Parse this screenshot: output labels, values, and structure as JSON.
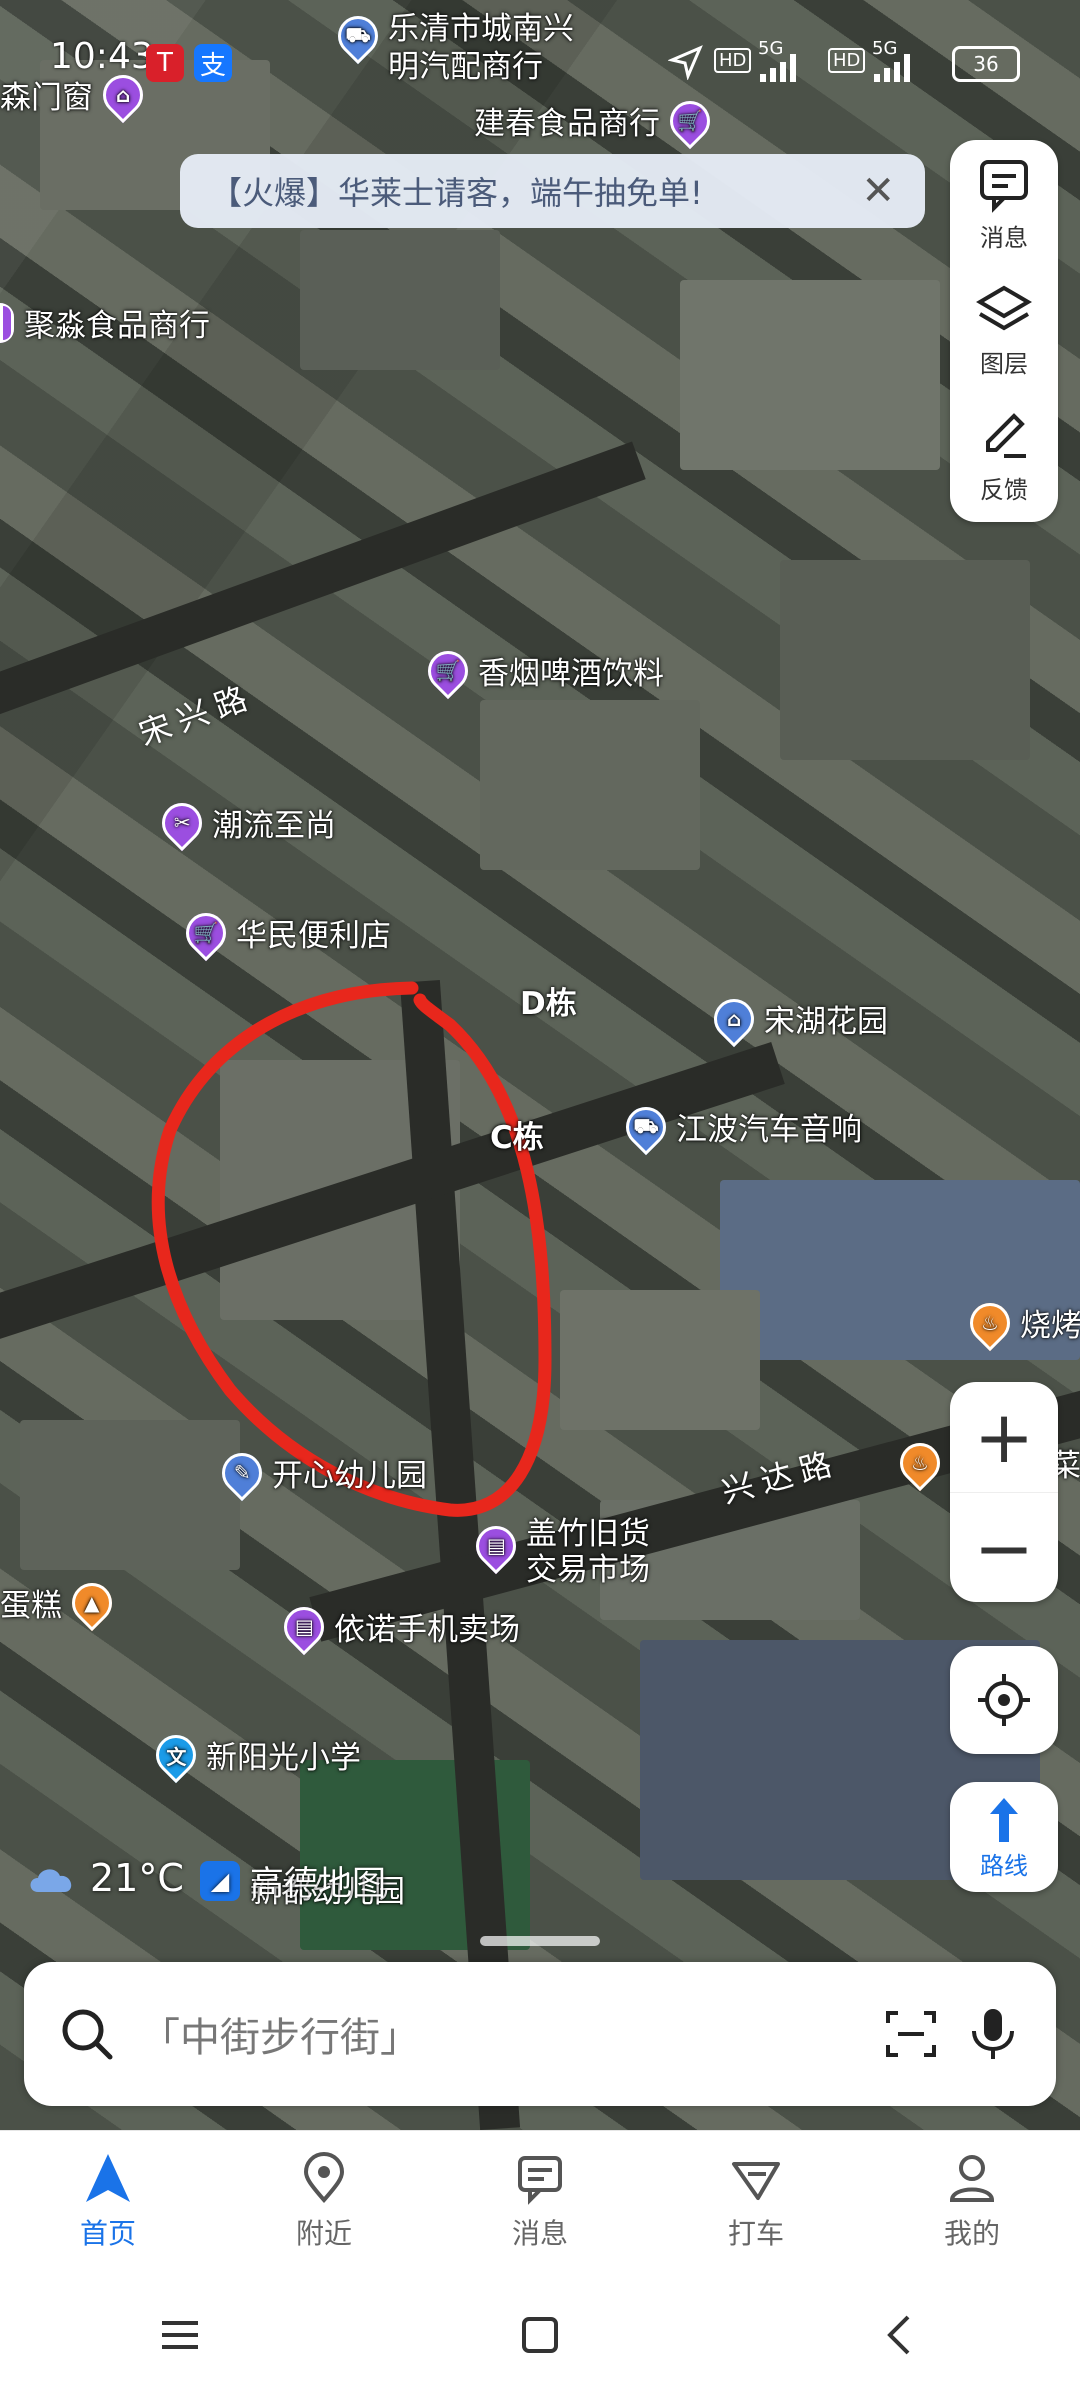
{
  "status": {
    "time": "10:43",
    "net1": "HD",
    "net2": "5G",
    "net3": "HD",
    "net4": "5G",
    "battery": "36"
  },
  "banner": {
    "text": "【火爆】华莱士请客，端午抽免单!"
  },
  "side_tools": {
    "message": "消息",
    "layers": "图层",
    "feedback": "反馈"
  },
  "map": {
    "pois": [
      {
        "label": "乐清市城南兴",
        "sub": "明汽配商行",
        "type": "car",
        "color": "#4f7fd8"
      },
      {
        "label": "森门窗",
        "type": "shop",
        "color": "#9b4ee0"
      },
      {
        "label": "建春食品商行",
        "type": "shop",
        "color": "#9b4ee0"
      },
      {
        "label": "聚淼食品商行",
        "type": "shop",
        "color": "#9b4ee0"
      },
      {
        "label": "香烟啤酒饮料",
        "type": "shop",
        "color": "#9b4ee0"
      },
      {
        "label": "潮流至尚",
        "type": "scissors",
        "color": "#9b4ee0"
      },
      {
        "label": "华民便利店",
        "type": "shop",
        "color": "#9b4ee0"
      },
      {
        "label": "D栋",
        "type": "none"
      },
      {
        "label": "C栋",
        "type": "none"
      },
      {
        "label": "宋湖花园",
        "type": "home",
        "color": "#4f7fd8"
      },
      {
        "label": "江波汽车音响",
        "type": "car",
        "color": "#4f7fd8"
      },
      {
        "label": "烧烤",
        "type": "food",
        "color": "#f08a2a"
      },
      {
        "label": "开心幼儿园",
        "type": "school",
        "color": "#4f7fd8"
      },
      {
        "label": "盖竹旧货",
        "sub": "交易市场",
        "type": "market",
        "color": "#9b4ee0"
      },
      {
        "label": "蛋糕",
        "type": "cake",
        "color": "#f08a2a"
      },
      {
        "label": "依诺手机卖场",
        "type": "market",
        "color": "#9b4ee0"
      },
      {
        "label": "新阳光小学",
        "type": "edu",
        "color": "#1a9be8"
      },
      {
        "label": "新都幼儿园",
        "type": "school",
        "color": "#4f7fd8"
      },
      {
        "label": "菜",
        "type": "food",
        "color": "#f08a2a"
      }
    ],
    "roads": [
      "宋兴路",
      "兴达路"
    ]
  },
  "weather": {
    "temp": "21°C"
  },
  "brand": {
    "name": "高德地图"
  },
  "route_label": "路线",
  "search": {
    "placeholder": "「中街步行街」"
  },
  "tabs": [
    {
      "label": "首页",
      "active": true
    },
    {
      "label": "附近"
    },
    {
      "label": "消息"
    },
    {
      "label": "打车"
    },
    {
      "label": "我的"
    }
  ],
  "colors": {
    "accent": "#1a73e8",
    "annotation": "#e8271c"
  }
}
